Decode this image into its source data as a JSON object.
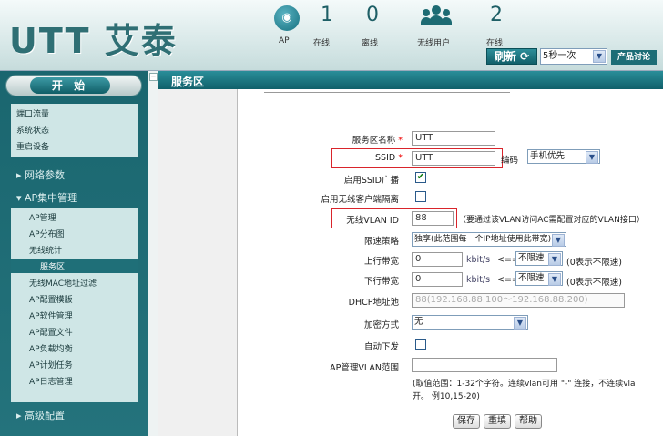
{
  "header": {
    "logo": "UTT 艾泰",
    "stats": [
      {
        "label": "AP",
        "value": ""
      },
      {
        "label": "在线",
        "value": "1"
      },
      {
        "label": "离线",
        "value": "0"
      },
      {
        "label": "无线用户",
        "value": ""
      },
      {
        "label": "在线",
        "value": "2"
      }
    ],
    "refresh_label": "刷新",
    "refresh_interval": "5秒一次",
    "forum_label": "产品讨论"
  },
  "sidebar": {
    "start_label": "开 始",
    "top_items": [
      "端口流量",
      "系统状态",
      "重启设备"
    ],
    "group_network": "▸ 网络参数",
    "group_ap": "▾ AP集中管理",
    "ap_items": [
      "AP管理",
      "AP分布图",
      "无线统计",
      "服务区",
      "无线MAC地址过滤",
      "AP配置模版",
      "AP软件管理",
      "AP配置文件",
      "AP负载均衡",
      "AP计划任务",
      "AP日志管理"
    ],
    "active_item": "服务区",
    "group_advanced": "▸ 高级配置"
  },
  "content": {
    "title": "服务区",
    "fields": {
      "zone_name_label": "服务区名称",
      "zone_name_value": "UTT",
      "ssid_label": "SSID",
      "ssid_value": "UTT",
      "encoding_label": "编码",
      "encoding_value": "手机优先",
      "ssid_broadcast_label": "启用SSID广播",
      "ssid_broadcast_checked": true,
      "client_isolation_label": "启用无线客户端隔离",
      "client_isolation_checked": false,
      "vlan_label": "无线VLAN ID",
      "vlan_value": "88",
      "vlan_note": "（要通过该VLAN访问AC需配置对应的VLAN接口）",
      "rate_policy_label": "限速策略",
      "rate_policy_value": "独享(此范围每一个IP地址使用此带宽)",
      "uplink_label": "上行带宽",
      "uplink_value": "0",
      "uplink_unit": "kbit/s",
      "uplink_arrow": "<==",
      "uplink_select": "不限速",
      "uplink_hint": "(0表示不限速)",
      "downlink_label": "下行带宽",
      "downlink_value": "0",
      "downlink_unit": "kbit/s",
      "downlink_arrow": "<==",
      "downlink_select": "不限速",
      "downlink_hint": "(0表示不限速)",
      "dhcp_label": "DHCP地址池",
      "dhcp_value": "88(192.168.88.100～192.168.88.200)",
      "encrypt_label": "加密方式",
      "encrypt_value": "无",
      "auto_push_label": "自动下发",
      "auto_push_checked": false,
      "ap_vlan_label": "AP管理VLAN范围",
      "ap_vlan_value": "",
      "range_note_1": "(取值范围：1-32个字符。连续vlan可用 \"-\" 连接，不连续vla",
      "range_note_2": "开。 例10,15-20)"
    },
    "buttons": {
      "save": "保存",
      "reset": "重填",
      "help": "帮助"
    }
  }
}
